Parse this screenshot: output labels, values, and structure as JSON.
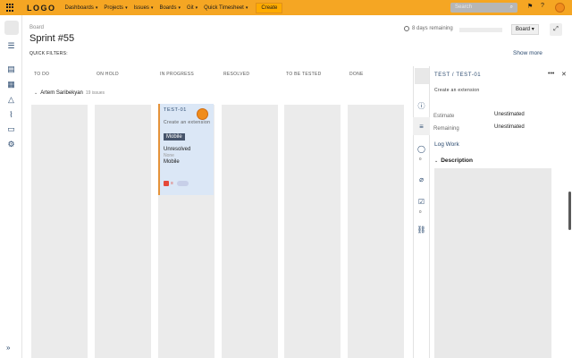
{
  "topbar": {
    "logo": "LOGO",
    "nav": [
      {
        "label": "Dashboards",
        "chev": "▾"
      },
      {
        "label": "Projects",
        "chev": "▾"
      },
      {
        "label": "Issues",
        "chev": "▾"
      },
      {
        "label": "Boards",
        "chev": "▾"
      },
      {
        "label": "Git",
        "chev": "▾"
      },
      {
        "label": "Quick Timesheet",
        "chev": "▾"
      }
    ],
    "create_label": "Create",
    "search_placeholder": "Search",
    "icons": [
      "search-icon",
      "notifications-icon",
      "help-icon",
      "avatar"
    ]
  },
  "sidebar": {
    "icons": [
      "backlog-icon",
      "board-icon",
      "kanban-icon",
      "releases-icon",
      "reports-icon",
      "issues-icon",
      "components-icon"
    ],
    "expand_glyph": "»"
  },
  "header": {
    "breadcrumb": "Board",
    "title": "Sprint #55",
    "remaining": "8 days remaining",
    "board_label": "Board",
    "board_chev": "▾",
    "quick_filters": "QUICK FILTERS:",
    "show_more": "Show more"
  },
  "columns": [
    "TO DO",
    "ON HOLD",
    "IN PROGRESS",
    "RESOLVED",
    "TO BE TESTED",
    "DONE"
  ],
  "swimlane": {
    "name": "Artem Saribekyan",
    "count": "19 issues"
  },
  "card": {
    "key": "TEST-01",
    "summary": "Create an extension",
    "label": "Mobile",
    "status": "Unresolved",
    "none": "None",
    "component": "Mobile",
    "priority_glyph": "≡"
  },
  "detail": {
    "key": "TEST / TEST-01",
    "summary": "Create an extension",
    "fields": [
      {
        "label": "Estimate",
        "value": "Unestimated"
      },
      {
        "label": "Remaining",
        "value": "Unestimated"
      }
    ],
    "log_work": "Log Work",
    "description": "Description",
    "comment_count": "0",
    "subtask_count": "0"
  },
  "colors": {
    "topbar": "#f5a623",
    "accent": "#2b4a6f",
    "card": "#dbe7f6"
  }
}
